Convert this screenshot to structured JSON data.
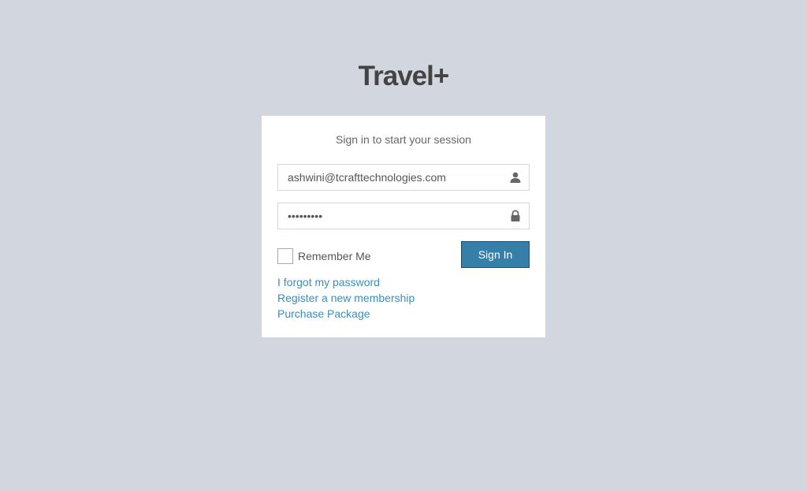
{
  "brand": {
    "logo_text": "Travel+"
  },
  "login": {
    "message": "Sign in to start your session",
    "email": {
      "value": "ashwini@tcrafttechnologies.com",
      "icon": "user-icon"
    },
    "password": {
      "value": "ashwini12",
      "icon": "lock-icon"
    },
    "remember_label": "Remember Me",
    "remember_checked": false,
    "signin_label": "Sign In",
    "links": {
      "forgot": "I forgot my password",
      "register": "Register a new membership",
      "purchase": "Purchase Package"
    }
  },
  "colors": {
    "background": "#d2d6de",
    "primary_button": "#367fa9",
    "link": "#3c8dbc"
  }
}
